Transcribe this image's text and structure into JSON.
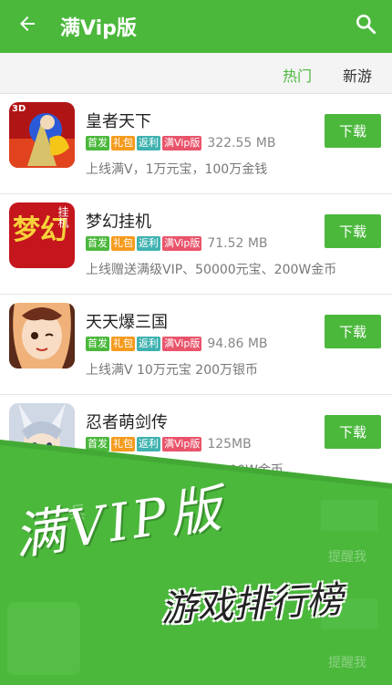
{
  "appbar": {
    "title": "满Vip版"
  },
  "tabs": [
    {
      "label": "热门"
    },
    {
      "label": "新游"
    }
  ],
  "tag_labels": [
    "首发",
    "礼包",
    "返利",
    "满Vip版"
  ],
  "download_label": "下载",
  "games": [
    {
      "name": "皇者天下",
      "size": "322.55 MB",
      "desc": "上线满V，1万元宝，100万金钱"
    },
    {
      "name": "梦幻挂机",
      "size": "71.52 MB",
      "desc": "上线赠送满级VIP、50000元宝、200W金币"
    },
    {
      "name": "天天爆三国",
      "size": "94.86 MB",
      "desc": "上线满V 10万元宝 200万银币"
    },
    {
      "name": "忍者萌剑传",
      "size": "125MB",
      "desc": "W钻石 100W金币"
    }
  ],
  "icon_texts": {
    "g1": "3D",
    "g2_big": "梦幻",
    "g2_small": "挂机"
  },
  "banner": {
    "line1": "满VIP版",
    "line2": "游戏排行榜",
    "partial": "兵",
    "partial_download": "提醒我"
  },
  "colors": {
    "accent": "#4bb83c",
    "tag_green": "#4bb83c",
    "tag_orange": "#f59b1e",
    "tag_teal": "#3fb2b0",
    "tag_red": "#e9546b"
  }
}
